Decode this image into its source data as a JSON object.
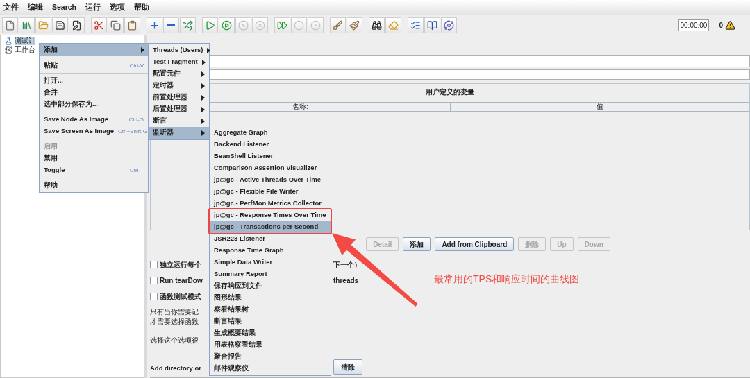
{
  "menubar": [
    {
      "label": "文件"
    },
    {
      "label": "编辑"
    },
    {
      "label": "Search"
    },
    {
      "label": "运行"
    },
    {
      "label": "选项"
    },
    {
      "label": "帮助"
    }
  ],
  "toolbar": [
    [
      {
        "disabled": false
      },
      {
        "disabled": false
      },
      {
        "disabled": false
      },
      {
        "disabled": false
      },
      {
        "disabled": false
      }
    ],
    [
      {
        "disabled": false
      },
      {
        "disabled": false
      },
      {
        "disabled": false
      }
    ],
    [
      {
        "disabled": false
      },
      {
        "disabled": false
      },
      {
        "disabled": false
      }
    ],
    [
      {
        "disabled": false
      },
      {
        "disabled": false
      },
      {
        "disabled": true
      },
      {
        "disabled": true
      }
    ],
    [
      {
        "disabled": false
      },
      {
        "disabled": true
      },
      {
        "disabled": true
      }
    ],
    [
      {
        "disabled": false
      },
      {
        "disabled": false
      }
    ],
    [
      {
        "disabled": false
      },
      {
        "disabled": false
      }
    ],
    [
      {
        "disabled": false
      },
      {
        "disabled": false
      },
      {
        "disabled": false
      }
    ]
  ],
  "timer": "00:00:00",
  "warning_count": "0",
  "tree": [
    {
      "label": "测试计",
      "selected": true
    },
    {
      "label": "工作台",
      "selected": false
    }
  ],
  "context_menu": [
    [
      {
        "label": "添加",
        "submenu": true,
        "selected": true,
        "disabled": false
      }
    ],
    [
      {
        "label": "粘贴",
        "shortcut": "Ctrl-V",
        "submenu": false,
        "selected": false,
        "disabled": false
      }
    ],
    [
      {
        "label": "打开...",
        "submenu": false,
        "selected": false,
        "disabled": false
      },
      {
        "label": "合并",
        "submenu": false,
        "selected": false,
        "disabled": false
      },
      {
        "label": "选中部分保存为...",
        "submenu": false,
        "selected": false,
        "disabled": false
      }
    ],
    [
      {
        "label": "Save Node As Image",
        "shortcut": "Ctrl-G",
        "submenu": false,
        "selected": false,
        "disabled": false
      },
      {
        "label": "Save Screen As Image",
        "shortcut": "Ctrl+Shift-G",
        "submenu": false,
        "selected": false,
        "disabled": false
      }
    ],
    [
      {
        "label": "启用",
        "submenu": false,
        "selected": false,
        "disabled": true
      },
      {
        "label": "禁用",
        "submenu": false,
        "selected": false,
        "disabled": false
      },
      {
        "label": "Toggle",
        "shortcut": "Ctrl-T",
        "submenu": false,
        "selected": false,
        "disabled": false
      }
    ],
    [
      {
        "label": "帮助",
        "submenu": false,
        "selected": false,
        "disabled": false
      }
    ]
  ],
  "add_menu": [
    {
      "label": "Threads (Users)",
      "selected": false
    },
    {
      "label": "Test Fragment",
      "selected": false
    },
    {
      "label": "配置元件",
      "selected": false
    },
    {
      "label": "定时器",
      "selected": false
    },
    {
      "label": "前置处理器",
      "selected": false
    },
    {
      "label": "后置处理器",
      "selected": false
    },
    {
      "label": "断言",
      "selected": false
    },
    {
      "label": "监听器",
      "selected": true
    }
  ],
  "listener_menu": [
    {
      "label": "Aggregate Graph",
      "selected": false,
      "boxed": false
    },
    {
      "label": "Backend Listener",
      "selected": false,
      "boxed": false
    },
    {
      "label": "BeanShell Listener",
      "selected": false,
      "boxed": false
    },
    {
      "label": "Comparison Assertion Visualizer",
      "selected": false,
      "boxed": false
    },
    {
      "label": "jp@gc - Active Threads Over Time",
      "selected": false,
      "boxed": false
    },
    {
      "label": "jp@gc - Flexible File Writer",
      "selected": false,
      "boxed": false
    },
    {
      "label": "jp@gc - PerfMon Metrics Collector",
      "selected": false,
      "boxed": false
    },
    {
      "label": "jp@gc - Response Times Over Time",
      "selected": false,
      "boxed": true
    },
    {
      "label": "jp@gc - Transactions per Second",
      "selected": true,
      "boxed": true
    },
    {
      "label": "JSR223 Listener",
      "selected": false,
      "boxed": false
    },
    {
      "label": "Response Time Graph",
      "selected": false,
      "boxed": false
    },
    {
      "label": "Simple Data Writer",
      "selected": false,
      "boxed": false
    },
    {
      "label": "Summary Report",
      "selected": false,
      "boxed": false
    },
    {
      "label": "保存响应到文件",
      "selected": false,
      "boxed": false
    },
    {
      "label": "图形结果",
      "selected": false,
      "boxed": false
    },
    {
      "label": "察看结果树",
      "selected": false,
      "boxed": false
    },
    {
      "label": "断言结果",
      "selected": false,
      "boxed": false
    },
    {
      "label": "生成概要结果",
      "selected": false,
      "boxed": false
    },
    {
      "label": "用表格察看结果",
      "selected": false,
      "boxed": false
    },
    {
      "label": "聚合报告",
      "selected": false,
      "boxed": false
    },
    {
      "label": "邮件观察仪",
      "selected": false,
      "boxed": false
    }
  ],
  "variables_table": {
    "title": "用户定义的变量",
    "columns": [
      "名称:",
      "值"
    ]
  },
  "table_buttons": [
    {
      "label": "Detail",
      "disabled": true
    },
    {
      "label": "添加",
      "disabled": false
    },
    {
      "label": "Add from Clipboard",
      "disabled": false
    },
    {
      "label": "删除",
      "disabled": true
    },
    {
      "label": "Up",
      "disabled": true
    },
    {
      "label": "Down",
      "disabled": true
    }
  ],
  "options": [
    {
      "kind": "checkbox",
      "checked": false,
      "label": "独立运行每个",
      "label_tail": "下一个）"
    },
    {
      "kind": "checkbox",
      "checked": false,
      "label": "Run tearDow",
      "label_tail": "threads"
    },
    {
      "kind": "checkbox",
      "checked": false,
      "label": "函数测试模式"
    },
    {
      "kind": "text",
      "label": "只有当你需要记"
    },
    {
      "kind": "text",
      "label": "才需要选择函数"
    },
    {
      "kind": "gap"
    },
    {
      "kind": "text",
      "label": "选择这个选项很"
    }
  ],
  "classpath": {
    "label": "Add directory or",
    "button": "清除"
  },
  "annotation": {
    "text": "最常用的TPS和响应时间的曲线图"
  }
}
